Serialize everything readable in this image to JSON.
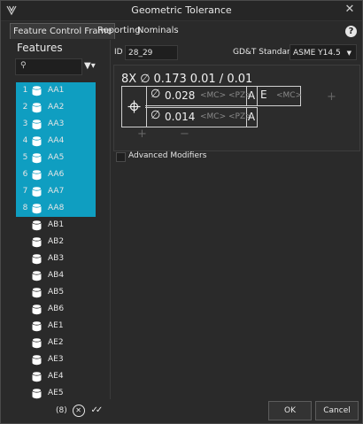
{
  "window": {
    "title": "Geometric Tolerance"
  },
  "tabs": [
    {
      "label": "Feature Control Frame",
      "active": true
    },
    {
      "label": "Reporting",
      "active": false
    },
    {
      "label": "Nominals",
      "active": false
    }
  ],
  "help_label": "?",
  "features": {
    "title": "Features",
    "search_placeholder": "",
    "items": [
      {
        "num": "1",
        "name": "AA1",
        "selected": true
      },
      {
        "num": "2",
        "name": "AA2",
        "selected": true
      },
      {
        "num": "3",
        "name": "AA3",
        "selected": true
      },
      {
        "num": "4",
        "name": "AA4",
        "selected": true
      },
      {
        "num": "5",
        "name": "AA5",
        "selected": true
      },
      {
        "num": "6",
        "name": "AA6",
        "selected": true
      },
      {
        "num": "7",
        "name": "AA7",
        "selected": true
      },
      {
        "num": "8",
        "name": "AA8",
        "selected": true
      },
      {
        "num": "",
        "name": "AB1",
        "selected": false
      },
      {
        "num": "",
        "name": "AB2",
        "selected": false
      },
      {
        "num": "",
        "name": "AB3",
        "selected": false
      },
      {
        "num": "",
        "name": "AB4",
        "selected": false
      },
      {
        "num": "",
        "name": "AB5",
        "selected": false
      },
      {
        "num": "",
        "name": "AB6",
        "selected": false
      },
      {
        "num": "",
        "name": "AE1",
        "selected": false
      },
      {
        "num": "",
        "name": "AE2",
        "selected": false
      },
      {
        "num": "",
        "name": "AE3",
        "selected": false
      },
      {
        "num": "",
        "name": "AE4",
        "selected": false
      },
      {
        "num": "",
        "name": "AE5",
        "selected": false
      }
    ],
    "selected_count": "(8)"
  },
  "id_field": {
    "label": "ID",
    "value": "28_29"
  },
  "standard": {
    "label": "GD&T Standard",
    "value": "ASME Y14.5"
  },
  "fcf": {
    "count": "8X",
    "diameter_symbol": "∅",
    "size": "0.173",
    "tolerance": "0.01 / 0.01",
    "rows": [
      {
        "dia": "∅",
        "value": "0.028",
        "mods": "<MC>  <PZ>",
        "datum_a": "A",
        "datum_b": "E",
        "datum_b_mod": "<MC>"
      },
      {
        "dia": "∅",
        "value": "0.014",
        "mods": "<MC>  <PZ>",
        "datum_a": "A"
      }
    ]
  },
  "advanced_modifiers": "Advanced Modifiers",
  "buttons": {
    "ok": "OK",
    "cancel": "Cancel"
  },
  "colors": {
    "selection": "#0f9ec1",
    "background": "#2a2a2a"
  }
}
